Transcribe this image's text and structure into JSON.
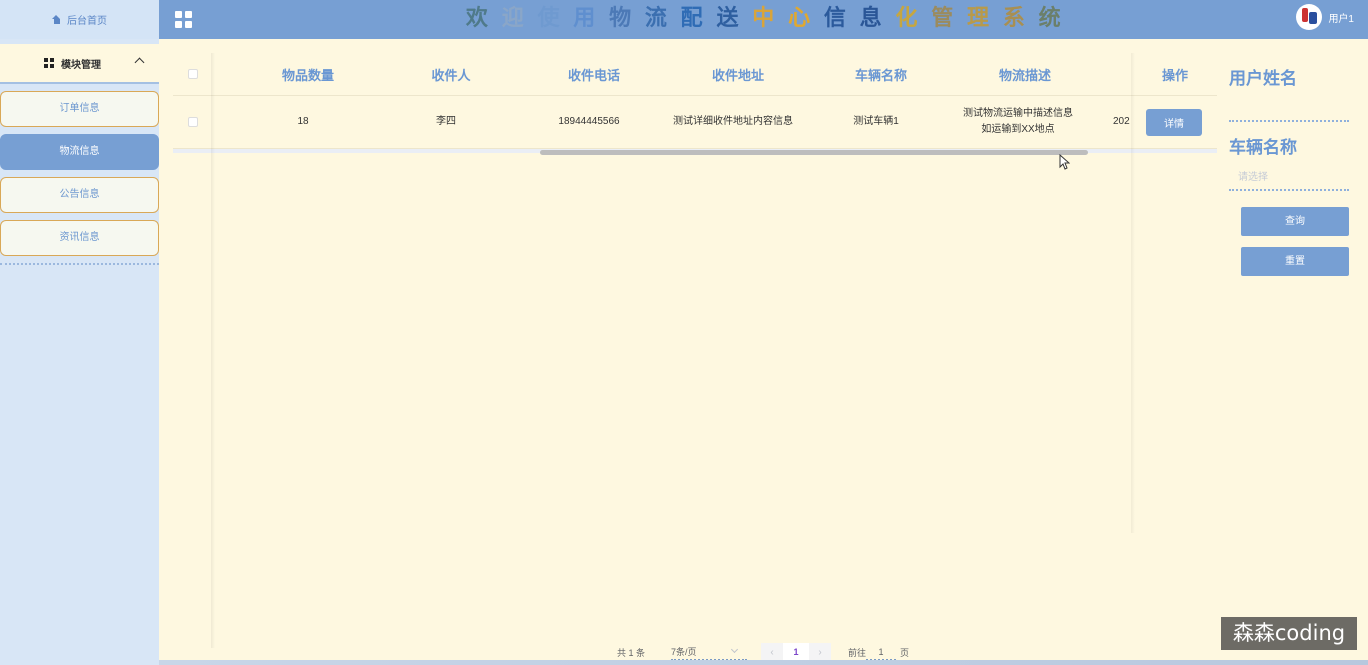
{
  "header": {
    "title_chars": [
      {
        "ch": "欢",
        "color": "#4f7a8a"
      },
      {
        "ch": "迎",
        "color": "#8aa6c8"
      },
      {
        "ch": "使",
        "color": "#6f9ad0"
      },
      {
        "ch": "用",
        "color": "#5f8fcf"
      },
      {
        "ch": "物",
        "color": "#4c79b6"
      },
      {
        "ch": "流",
        "color": "#3b6fb0"
      },
      {
        "ch": "配",
        "color": "#2f6cb5"
      },
      {
        "ch": "送",
        "color": "#2e5fa0"
      },
      {
        "ch": "中",
        "color": "#d9a43a"
      },
      {
        "ch": "心",
        "color": "#e0a830"
      },
      {
        "ch": "信",
        "color": "#2b5a9c"
      },
      {
        "ch": "息",
        "color": "#2a5697"
      },
      {
        "ch": "化",
        "color": "#c6a640"
      },
      {
        "ch": "管",
        "color": "#9b8b5e"
      },
      {
        "ch": "理",
        "color": "#b89a4a"
      },
      {
        "ch": "系",
        "color": "#a88f52"
      },
      {
        "ch": "统",
        "color": "#6b7f6a"
      }
    ],
    "user_name": "用户1"
  },
  "sidebar": {
    "home_label": "后台首页",
    "module_label": "模块管理",
    "items": [
      {
        "label": "订单信息",
        "active": false
      },
      {
        "label": "物流信息",
        "active": true
      },
      {
        "label": "公告信息",
        "active": false
      },
      {
        "label": "资讯信息",
        "active": false
      }
    ]
  },
  "table": {
    "headers": [
      "物品数量",
      "收件人",
      "收件电话",
      "收件地址",
      "车辆名称",
      "物流描述",
      "操作"
    ],
    "row": {
      "quantity": "18",
      "recipient": "李四",
      "phone": "18944445566",
      "address": "测试详细收件地址内容信息",
      "vehicle": "测试车辆1",
      "description": "测试物流运输中描述信息 如运输到XX地点",
      "date_partial": "202",
      "detail_label": "详情"
    }
  },
  "search": {
    "user_label": "用户姓名",
    "vehicle_label": "车辆名称",
    "vehicle_placeholder": "请选择",
    "query_label": "查询",
    "reset_label": "重置"
  },
  "pagination": {
    "total": "共 1 条",
    "page_size": "7条/页",
    "prev": "‹",
    "current": "1",
    "next": "›",
    "goto_label": "前往",
    "goto_value": "1",
    "page_suffix": "页"
  },
  "watermark": "森森coding",
  "colors": {
    "accent": "#779fd3",
    "background": "#fef8e0",
    "sidebar": "#d8e6f6",
    "menu_border": "#d9a857"
  }
}
